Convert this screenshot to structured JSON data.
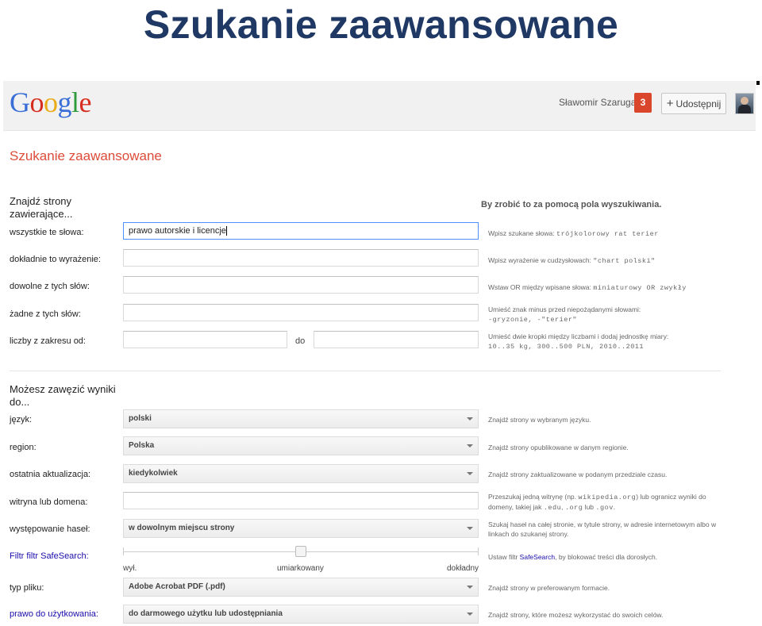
{
  "slide": {
    "title": "Szukanie zaawansowane"
  },
  "header": {
    "username": "Sławomir Szaruga",
    "notifications": "3",
    "share_plus": "+",
    "share_label": "Udostępnij"
  },
  "page": {
    "heading": "Szukanie zaawansowane"
  },
  "find": {
    "heading": "Znajdź strony zawierające...",
    "hint_heading": "By zrobić to za pomocą pola wyszukiwania.",
    "all_words_label": "wszystkie te słowa:",
    "all_words_value": "prawo autorskie i licencje",
    "exact_label": "dokładnie to wyrażenie:",
    "any_label": "dowolne z tych słów:",
    "none_label": "żadne z tych słów:",
    "range_label": "liczby z zakresu od:",
    "range_to": "do",
    "hint_all_text": "Wpisz szukane słowa: ",
    "hint_all_code": "trójkolorowy rat terier",
    "hint_exact_text": "Wpisz wyrażenie w cudzysłowach: ",
    "hint_exact_code": "\"chart polski\"",
    "hint_any_text": "Wstaw OR między wpisane słowa: ",
    "hint_any_code": "miniaturowy OR zwykły",
    "hint_none_text": "Umieść znak minus przed niepożądanymi słowami:",
    "hint_none_code": "-gryzonie, -\"terier\"",
    "hint_range_text": "Umieść dwie kropki między liczbami i dodaj jednostkę miary:",
    "hint_range_code": "10..35 kg, 300..500 PLN, 2010..2011"
  },
  "narrow": {
    "heading": "Możesz zawęzić wyniki do...",
    "language_label": "język:",
    "language_value": "polski",
    "language_hint": "Znajdź strony w wybranym języku.",
    "region_label": "region:",
    "region_value": "Polska",
    "region_hint": "Znajdź strony opublikowane w danym regionie.",
    "update_label": "ostatnia aktualizacja:",
    "update_value": "kiedykolwiek",
    "update_hint": "Znajdź strony zaktualizowane w podanym przedziale czasu.",
    "site_label": "witryna lub domena:",
    "site_hint_a": "Przeszukaj jedną witrynę (np. ",
    "site_hint_code1": "wikipedia.org",
    "site_hint_b": ") lub ogranicz wyniki do domeny, takiej jak ",
    "site_hint_code2": ".edu",
    "site_hint_c": ", ",
    "site_hint_code3": ".org",
    "site_hint_d": " lub ",
    "site_hint_code4": ".gov",
    "site_hint_e": ".",
    "terms_label": "występowanie haseł:",
    "terms_value": "w dowolnym miejscu strony",
    "terms_hint": "Szukaj haseł na całej stronie, w tytule strony, w adresie internetowym albo w linkach do szukanej strony.",
    "safesearch_label": "Filtr filtr SafeSearch:",
    "safesearch_hint_a": "Ustaw filtr ",
    "safesearch_hint_link": "SafeSearch",
    "safesearch_hint_b": ", by blokować treści dla dorosłych.",
    "safesearch_level": 0.5,
    "slider_low": "wył.",
    "slider_mid": "umiarkowany",
    "slider_high": "dokładny",
    "filetype_label": "typ pliku:",
    "filetype_value": "Adobe Acrobat PDF (.pdf)",
    "filetype_hint": "Znajdź strony w preferowanym formacie.",
    "rights_label": "prawo do użytkowania:",
    "rights_value": "do darmowego użytku lub udostępniania",
    "rights_hint": "Znajdź strony, które możesz wykorzystać do swoich celów."
  }
}
